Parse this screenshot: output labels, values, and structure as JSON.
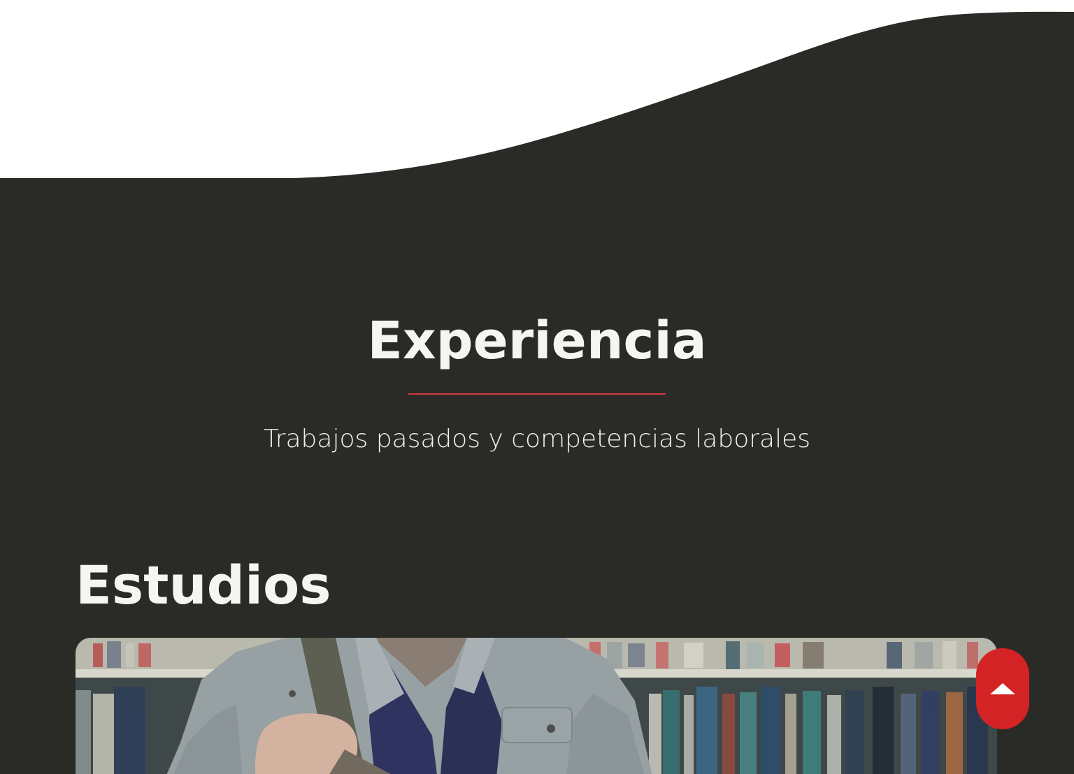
{
  "experience": {
    "title": "Experiencia",
    "subtitle": "Trabajos pasados y competencias laborales"
  },
  "studies": {
    "title": "Estudios",
    "image_icon": "student-library-photo"
  },
  "scroll_top": {
    "icon": "arrow-up-icon"
  },
  "colors": {
    "dark_background": "#2a2a26",
    "accent": "#d42324",
    "divider": "#d23a3a"
  }
}
